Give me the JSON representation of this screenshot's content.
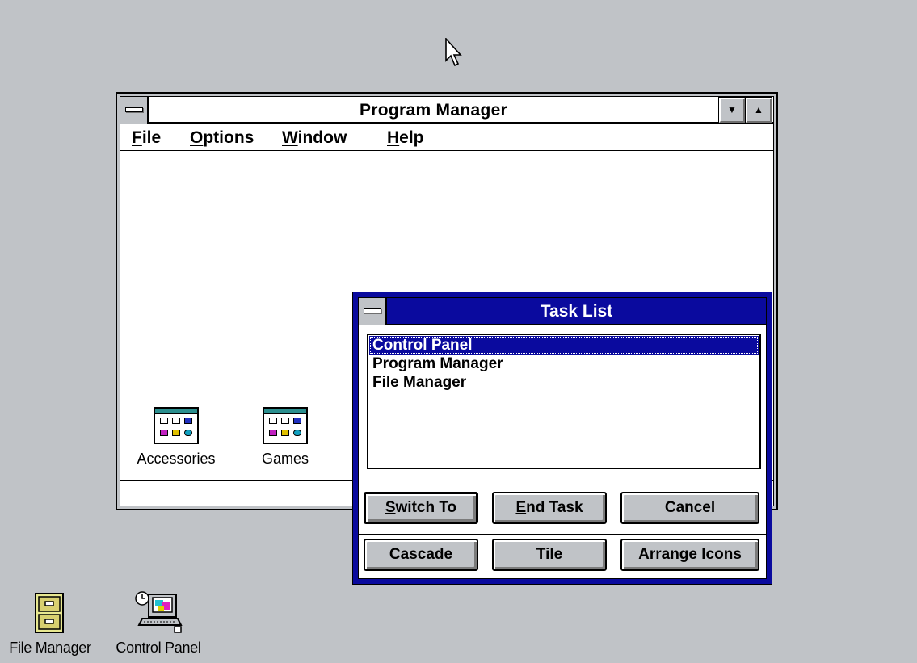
{
  "program_manager": {
    "title": "Program Manager",
    "menu": [
      {
        "label": "File",
        "accel": "F",
        "rest": "ile"
      },
      {
        "label": "Options",
        "accel": "O",
        "rest": "ptions"
      },
      {
        "label": "Window",
        "accel": "W",
        "rest": "indow"
      },
      {
        "label": "Help",
        "accel": "H",
        "rest": "elp"
      }
    ],
    "minimize_glyph": "▼",
    "maximize_glyph": "▲",
    "groups": [
      {
        "label": "Accessories",
        "icon": "program-group-icon"
      },
      {
        "label": "Games",
        "icon": "program-group-icon"
      }
    ]
  },
  "task_list": {
    "title": "Task List",
    "tasks": [
      "Control Panel",
      "Program Manager",
      "File Manager"
    ],
    "selected_index": 0,
    "buttons_row1": [
      {
        "label": "Switch To",
        "accel": "S",
        "rest": "witch To"
      },
      {
        "label": "End Task",
        "accel": "E",
        "rest": "nd Task"
      },
      {
        "label": "Cancel",
        "accel": "",
        "rest": "Cancel"
      }
    ],
    "buttons_row2": [
      {
        "label": "Cascade",
        "accel": "C",
        "rest": "ascade"
      },
      {
        "label": "Tile",
        "accel": "T",
        "rest": "ile"
      },
      {
        "label": "Arrange Icons",
        "accel": "A",
        "rest": "rrange Icons"
      }
    ]
  },
  "desktop_icons": [
    {
      "label": "File Manager",
      "icon": "file-cabinet-icon"
    },
    {
      "label": "Control Panel",
      "icon": "control-panel-icon"
    }
  ],
  "colors": {
    "desktop": "#c0c3c7",
    "active_title": "#0a0a9e",
    "window_bg": "#ffffff",
    "button_face": "#c0c3c7"
  }
}
